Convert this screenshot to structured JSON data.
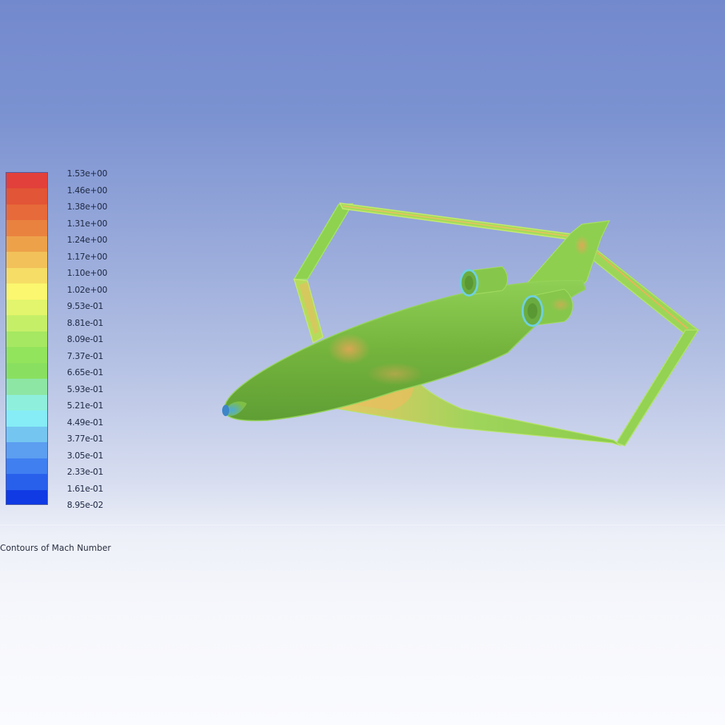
{
  "plot": {
    "title": "Contours of Mach Number"
  },
  "colormap": {
    "labels": [
      "1.53e+00",
      "1.46e+00",
      "1.38e+00",
      "1.31e+00",
      "1.24e+00",
      "1.17e+00",
      "1.10e+00",
      "1.02e+00",
      "9.53e-01",
      "8.81e-01",
      "8.09e-01",
      "7.37e-01",
      "6.65e-01",
      "5.93e-01",
      "5.21e-01",
      "4.49e-01",
      "3.77e-01",
      "3.05e-01",
      "2.33e-01",
      "1.61e-01",
      "8.95e-02"
    ],
    "colors": [
      "#e2403a",
      "#e25536",
      "#e66a3a",
      "#e9823f",
      "#eda24a",
      "#f2c15a",
      "#f6dd66",
      "#fbf76e",
      "#e2f56c",
      "#c6ef68",
      "#a6e862",
      "#92e45c",
      "#89e060",
      "#8ee6a4",
      "#8ef0dc",
      "#86ecf6",
      "#74c6f0",
      "#5c9ef0",
      "#3f7ff0",
      "#2860ec",
      "#0f3ae4"
    ]
  },
  "model": {
    "surface_color": "#7fbf45",
    "edge_color": "#9fe060",
    "hot_color": "#e9b455",
    "cold_color": "#6fd0e0"
  }
}
